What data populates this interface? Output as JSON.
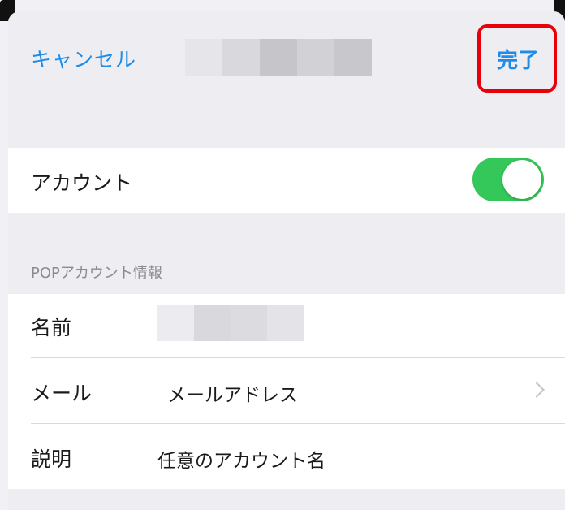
{
  "navbar": {
    "cancel_label": "キャンセル",
    "done_label": "完了",
    "title_blur_colors": [
      "#e6e6ea",
      "#d9d9dd",
      "#c6c6ca",
      "#d2d2d6",
      "#c8c8cc"
    ]
  },
  "account_row": {
    "label": "アカウント",
    "toggle_on": true,
    "toggle_color": "#34c759"
  },
  "section_header": "POPアカウント情報",
  "fields": [
    {
      "label": "名前",
      "value": "",
      "name_blur_colors": [
        "#ececf0",
        "#d9d9dd",
        "#dcdce0",
        "#e4e4e8"
      ]
    },
    {
      "label": "メール",
      "value": "メールアドレス"
    },
    {
      "label": "説明",
      "value": "任意のアカウント名"
    }
  ],
  "highlight_color": "#e8000b",
  "accent_color": "#1e8ce8"
}
